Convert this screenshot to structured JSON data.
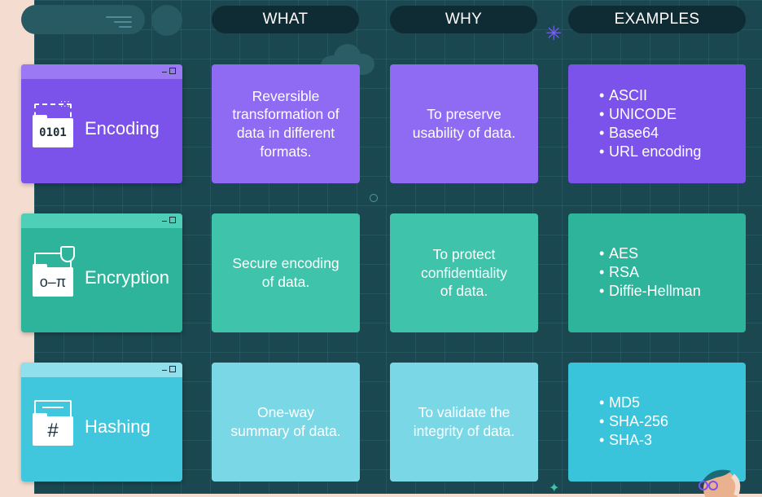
{
  "headers": {
    "what": "WHAT",
    "why": "WHY",
    "examples": "EXAMPLES"
  },
  "rows": [
    {
      "name": "Encoding",
      "icon": "binary-folder-icon",
      "icon_text": "0101",
      "what": "Reversible\ntransformation of\ndata in different\nformats.",
      "why": "To preserve\nusability of data.",
      "examples": [
        "ASCII",
        "UNICODE",
        "Base64",
        "URL encoding"
      ],
      "color": "#7b52ea"
    },
    {
      "name": "Encryption",
      "icon": "key-folder-icon",
      "what": "Secure encoding\nof data.",
      "why": "To protect\nconfidentiality\nof data.",
      "examples": [
        "AES",
        "RSA",
        "Diffie-Hellman"
      ],
      "color": "#2fb49c"
    },
    {
      "name": "Hashing",
      "icon": "hash-folder-icon",
      "icon_text": "#",
      "what": "One-way\nsummary of data.",
      "why": "To validate the\nintegrity of data.",
      "examples": [
        "MD5",
        "SHA-256",
        "SHA-3"
      ],
      "color": "#41c7dd"
    }
  ]
}
